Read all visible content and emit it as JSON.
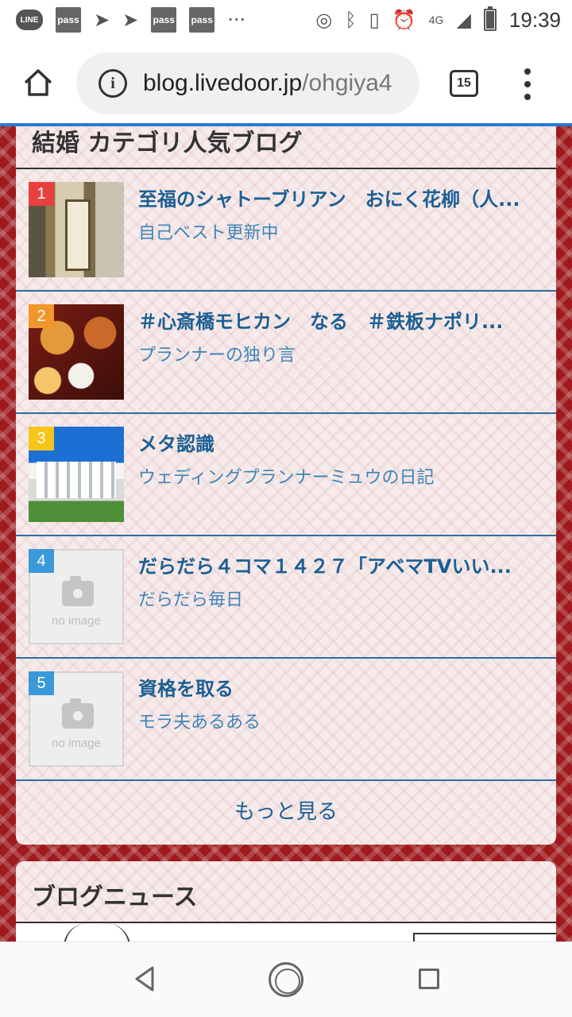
{
  "status_bar": {
    "time": "19:39",
    "network": "4G",
    "left_icons": [
      "line-icon",
      "pass-icon",
      "paper-plane-icon",
      "paper-plane-icon",
      "pass-icon",
      "pass-icon"
    ],
    "line_label": "LINE",
    "pass_label": "pass",
    "more_label": "···"
  },
  "browser": {
    "url_host": "blog.livedoor.jp",
    "url_path": "/ohgiya4",
    "tab_count": "15"
  },
  "ranking": {
    "heading": "結婚 カテゴリ人気ブログ",
    "rank_colors": [
      "#e8403f",
      "#f0962a",
      "#f5c51c",
      "#3a9ad9",
      "#3a9ad9"
    ],
    "items": [
      {
        "rank": "1",
        "title": "至福のシャトーブリアン　おにく花柳（人...",
        "blog": "自己ベスト更新中",
        "thumb": "restaurant-photo"
      },
      {
        "rank": "2",
        "title": "＃心斎橋モヒカン　なる　＃鉄板ナポリ...",
        "blog": "プランナーの独り言",
        "thumb": "food-photo"
      },
      {
        "rank": "3",
        "title": "メタ認識",
        "blog": "ウェディングプランナーミュウの日記",
        "thumb": "wedding-venue-photo"
      },
      {
        "rank": "4",
        "title": "だらだら４コマ１４２７「アベマTVいい...",
        "blog": "だらだら毎日",
        "thumb": "no-image"
      },
      {
        "rank": "5",
        "title": "資格を取る",
        "blog": "モラ夫あるある",
        "thumb": "no-image"
      }
    ],
    "no_image_label": "no image",
    "more_label": "もっと見る"
  },
  "news": {
    "heading": "ブログニュース"
  }
}
